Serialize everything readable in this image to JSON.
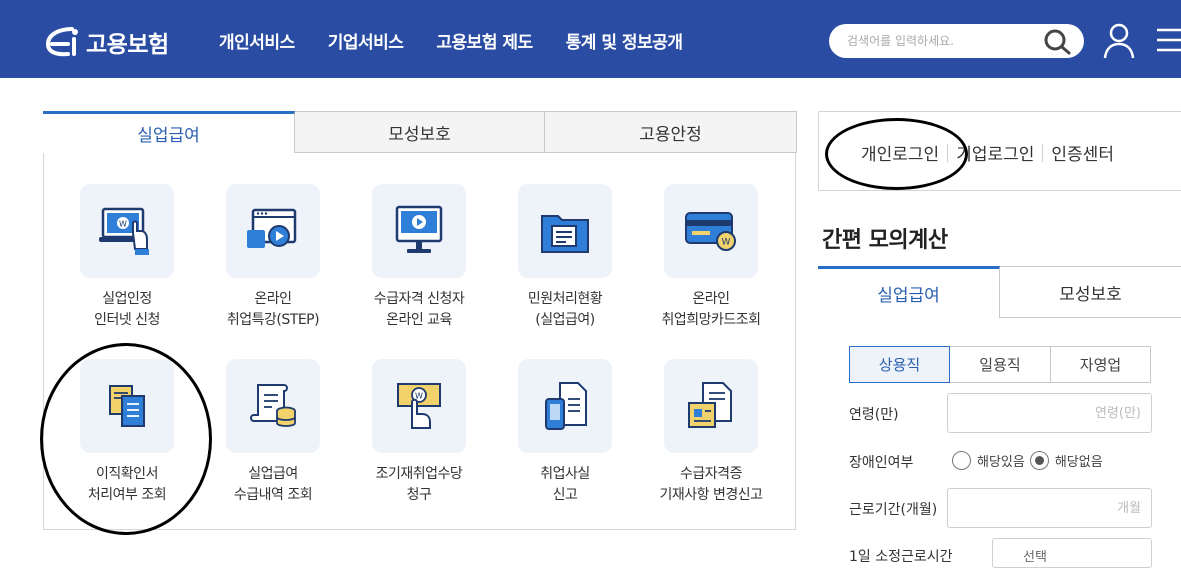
{
  "header": {
    "logo_text": "고용보험",
    "nav": [
      "개인서비스",
      "기업서비스",
      "고용보험 제도",
      "통계 및 정보공개"
    ],
    "search_placeholder": "검색어를 입력하세요."
  },
  "service_tabs": [
    "실업급여",
    "모성보호",
    "고용안정"
  ],
  "services": [
    {
      "line1": "실업인정",
      "line2": "인터넷 신청",
      "icon": "laptop-hand-icon"
    },
    {
      "line1": "온라인",
      "line2": "취업특강(STEP)",
      "icon": "video-window-icon"
    },
    {
      "line1": "수급자격 신청자",
      "line2": "온라인 교육",
      "icon": "monitor-play-icon"
    },
    {
      "line1": "민원처리현황",
      "line2": "(실업급여)",
      "icon": "folder-document-icon"
    },
    {
      "line1": "온라인",
      "line2": "취업희망카드조회",
      "icon": "card-icon"
    },
    {
      "line1": "이직확인서",
      "line2": "처리여부 조회",
      "icon": "documents-icon"
    },
    {
      "line1": "실업급여",
      "line2": "수급내역 조회",
      "icon": "receipt-coins-icon"
    },
    {
      "line1": "조기재취업수당",
      "line2": "청구",
      "icon": "hand-money-icon"
    },
    {
      "line1": "취업사실",
      "line2": "신고",
      "icon": "phone-document-icon"
    },
    {
      "line1": "수급자격증",
      "line2": "기재사항 변경신고",
      "icon": "document-change-icon"
    }
  ],
  "login_links": [
    "개인로그인",
    "기업로그인",
    "인증센터"
  ],
  "calc": {
    "title": "간편 모의계산",
    "tabs": [
      "실업급여",
      "모성보호"
    ],
    "segments": [
      "상용직",
      "일용직",
      "자영업"
    ],
    "age_label": "연령(만)",
    "age_placeholder": "연령(만)",
    "disability_label": "장애인여부",
    "disability_options": [
      "해당있음",
      "해당없음"
    ],
    "disability_selected": "해당없음",
    "period_label": "근로기간(개월)",
    "period_placeholder": "개월",
    "hours_label": "1일 소정근로시간",
    "hours_select": "선택"
  },
  "colors": {
    "header_bg": "#2a4da3",
    "accent": "#2a6fc6",
    "icon_bg": "#eef3f9"
  }
}
